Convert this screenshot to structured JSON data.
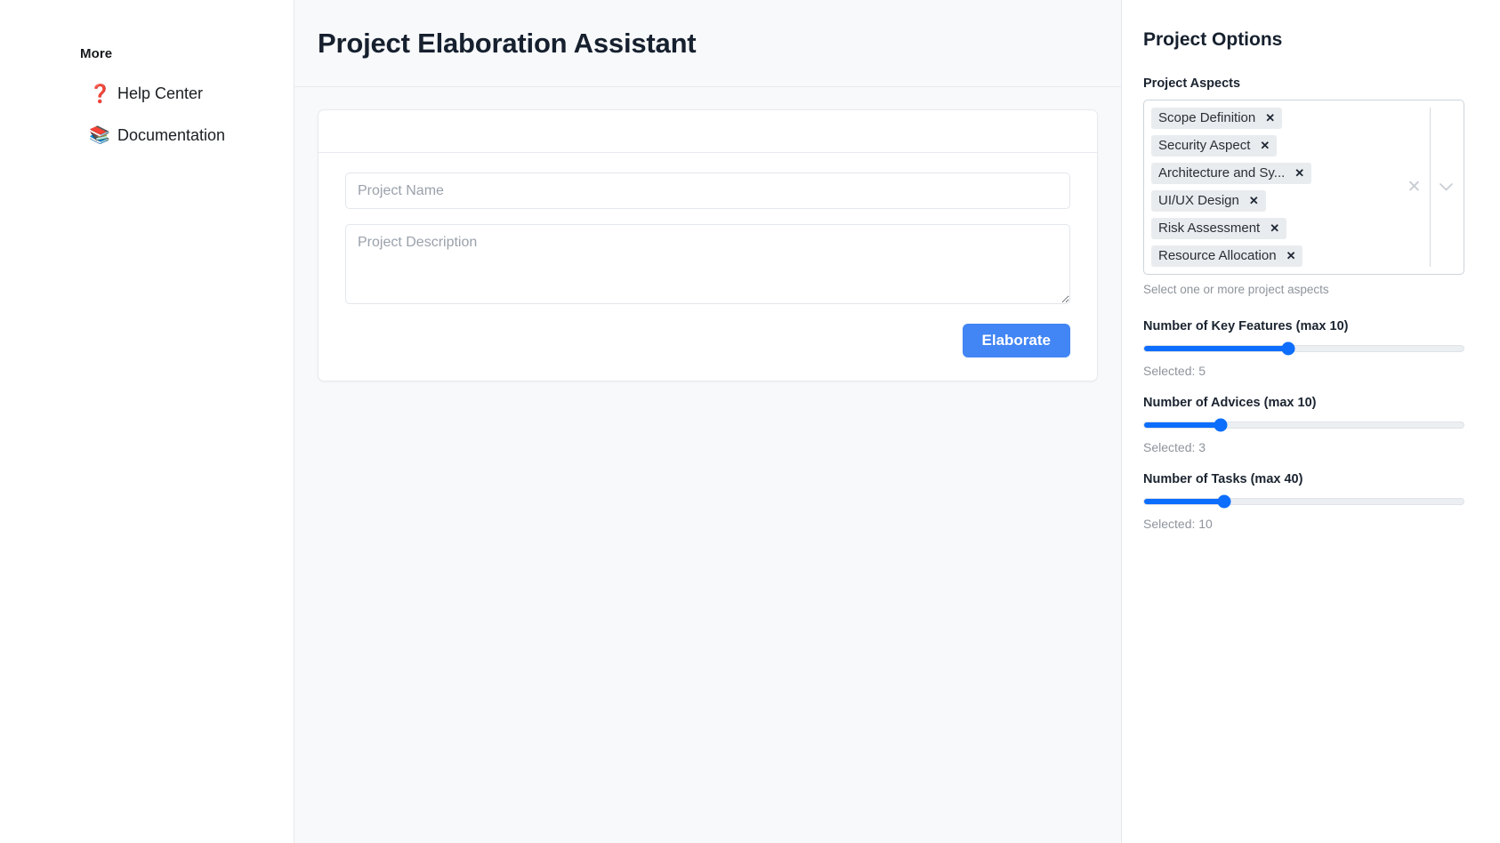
{
  "sidebar": {
    "section_title": "More",
    "items": [
      {
        "label": "Help Center",
        "icon": "question-mark-icon",
        "glyph": "❓"
      },
      {
        "label": "Documentation",
        "icon": "books-icon",
        "glyph": "📚"
      }
    ]
  },
  "main": {
    "title": "Project Elaboration Assistant",
    "form": {
      "project_name_placeholder": "Project Name",
      "project_name_value": "",
      "project_description_placeholder": "Project Description",
      "project_description_value": "",
      "submit_label": "Elaborate"
    }
  },
  "options": {
    "title": "Project Options",
    "aspects": {
      "label": "Project Aspects",
      "help_text": "Select one or more project aspects",
      "remove_glyph": "✕",
      "clear_glyph": "✕",
      "selected": [
        "Scope Definition",
        "Security Aspect",
        "Architecture and Sy...",
        "UI/UX Design",
        "Risk Assessment",
        "Resource Allocation"
      ]
    },
    "sliders": [
      {
        "label": "Number of Key Features (max 10)",
        "value_label": "Selected: 5",
        "value": 5,
        "min": 1,
        "max": 10,
        "percent": 45
      },
      {
        "label": "Number of Advices (max 10)",
        "value_label": "Selected: 3",
        "value": 3,
        "min": 1,
        "max": 10,
        "percent": 24
      },
      {
        "label": "Number of Tasks (max 40)",
        "value_label": "Selected: 10",
        "value": 10,
        "min": 1,
        "max": 40,
        "percent": 25
      }
    ]
  },
  "colors": {
    "primary_button": "#4285f4",
    "slider_fill": "#0d6efd",
    "panel_bg": "#f8f9fb",
    "tag_bg": "#e9ecef"
  }
}
